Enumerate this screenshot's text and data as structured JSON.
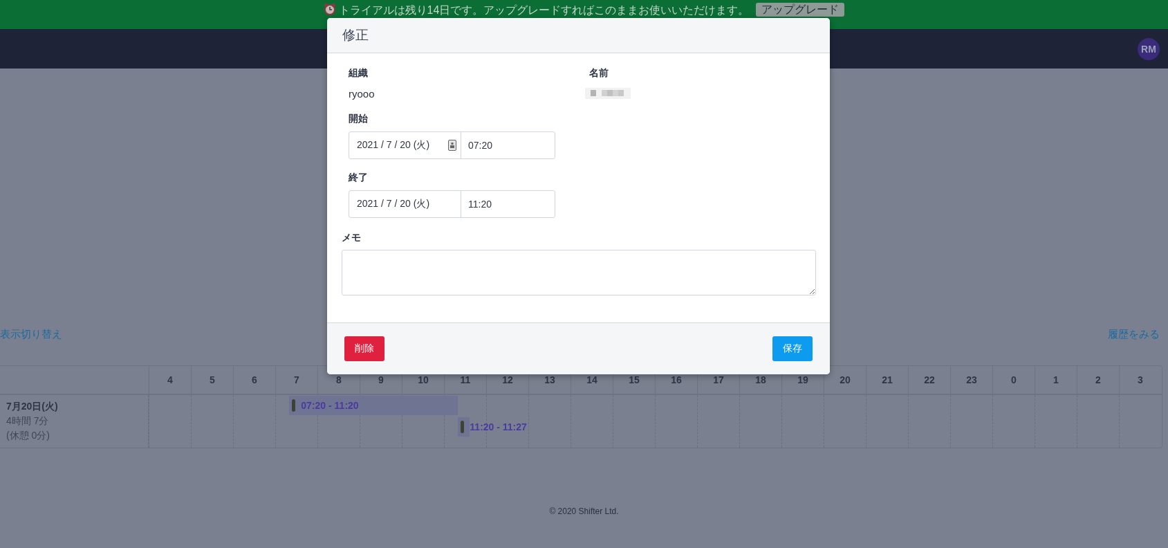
{
  "trial_banner": {
    "message": "トライアルは残り14日です。アップグレードすればこのままお使いいただけます。",
    "button": "アップグレード"
  },
  "nav": {
    "avatar": "RM"
  },
  "toolbar": {
    "view_toggle": "表示切り替え",
    "history_link": "履歴をみる"
  },
  "timeline": {
    "hours": [
      "4",
      "5",
      "6",
      "7",
      "8",
      "9",
      "10",
      "11",
      "12",
      "13",
      "14",
      "15",
      "16",
      "17",
      "18",
      "19",
      "20",
      "21",
      "22",
      "23",
      "0",
      "1",
      "2",
      "3"
    ],
    "rows": [
      {
        "date": "7月20日(火)",
        "total": "4時間 7分",
        "break": "(休憩 0分)",
        "entries": [
          {
            "label": "07:20 - 11:20"
          },
          {
            "label": "11:20 - 11:27"
          }
        ]
      }
    ]
  },
  "footer": {
    "copyright": "© 2020 Shifter Ltd."
  },
  "modal": {
    "title": "修正",
    "organization": {
      "label": "組織",
      "value": "ryooo"
    },
    "name": {
      "label": "名前"
    },
    "start": {
      "label": "開始",
      "date": "2021 / 7 / 20 (火)",
      "time": "07:20",
      "focused": true
    },
    "end": {
      "label": "終了",
      "date": "2021 / 7 / 20 (火)",
      "time": "11:20",
      "focused": false
    },
    "memo": {
      "label": "メモ"
    },
    "delete_button": "削除",
    "save_button": "保存"
  }
}
